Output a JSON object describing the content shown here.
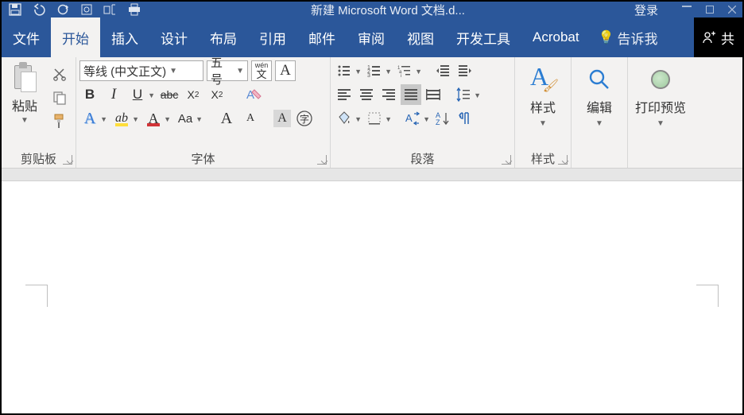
{
  "title": "新建 Microsoft Word 文档.d...",
  "login": "登录",
  "tabs": {
    "file": "文件",
    "home": "开始",
    "insert": "插入",
    "design": "设计",
    "layout": "布局",
    "references": "引用",
    "mailings": "邮件",
    "review": "审阅",
    "view": "视图",
    "developer": "开发工具",
    "acrobat": "Acrobat",
    "tellme": "告诉我",
    "share": "共"
  },
  "clipboard": {
    "paste": "粘贴",
    "group": "剪贴板"
  },
  "font": {
    "name": "等线 (中文正文)",
    "size": "五号",
    "pinyin_top": "wén",
    "pinyin_bottom": "文",
    "charA": "A",
    "bold": "B",
    "italic": "I",
    "underline": "U",
    "strike": "abc",
    "sub_x": "X",
    "sup_x": "X",
    "aa": "Aa",
    "bigA": "A",
    "smallA": "A",
    "circleChar": "字",
    "group": "字体"
  },
  "para": {
    "group": "段落",
    "az": "A",
    "z": "Z"
  },
  "styles": {
    "btn": "样式",
    "group": "样式"
  },
  "edit": {
    "btn": "编辑"
  },
  "preview": {
    "btn": "打印预览"
  }
}
